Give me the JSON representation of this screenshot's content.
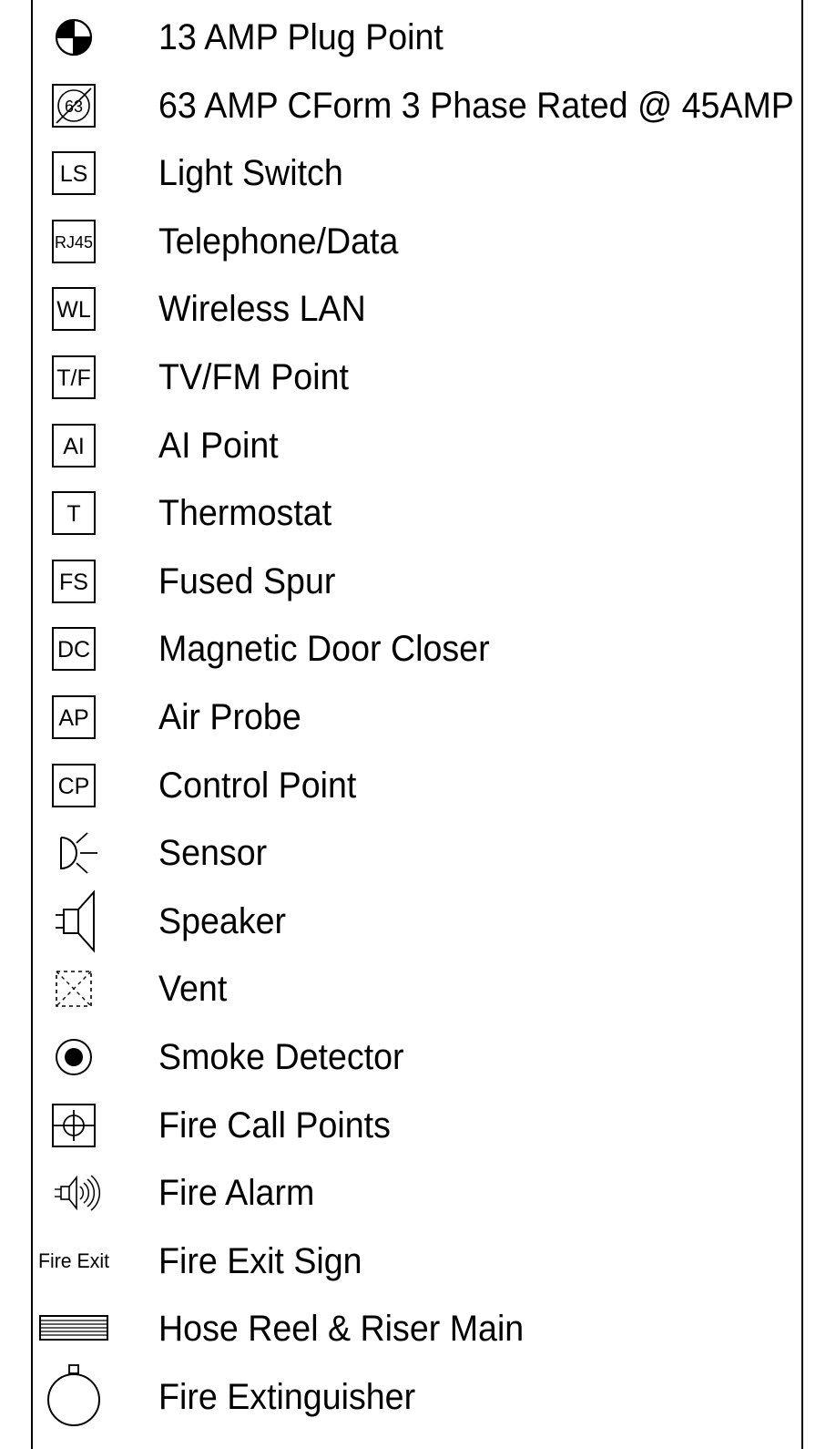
{
  "legend": {
    "items": [
      {
        "label": "13 AMP Plug Point",
        "icon": "plug-point-icon"
      },
      {
        "label": "63 AMP CForm 3 Phase Rated @ 45AMP",
        "icon": "cform-63-icon",
        "symbol_text": "63"
      },
      {
        "label": "Light Switch",
        "icon": "light-switch-icon",
        "symbol_text": "LS"
      },
      {
        "label": "Telephone/Data",
        "icon": "telephone-data-icon",
        "symbol_text": "RJ45"
      },
      {
        "label": "Wireless LAN",
        "icon": "wireless-lan-icon",
        "symbol_text": "WL"
      },
      {
        "label": "TV/FM Point",
        "icon": "tv-fm-icon",
        "symbol_text": "T/F"
      },
      {
        "label": "AI Point",
        "icon": "ai-point-icon",
        "symbol_text": "AI"
      },
      {
        "label": "Thermostat",
        "icon": "thermostat-icon",
        "symbol_text": "T"
      },
      {
        "label": "Fused Spur",
        "icon": "fused-spur-icon",
        "symbol_text": "FS"
      },
      {
        "label": "Magnetic Door Closer",
        "icon": "door-closer-icon",
        "symbol_text": "DC"
      },
      {
        "label": "Air Probe",
        "icon": "air-probe-icon",
        "symbol_text": "AP"
      },
      {
        "label": "Control Point",
        "icon": "control-point-icon",
        "symbol_text": "CP"
      },
      {
        "label": "Sensor",
        "icon": "sensor-icon"
      },
      {
        "label": "Speaker",
        "icon": "speaker-icon"
      },
      {
        "label": "Vent",
        "icon": "vent-icon"
      },
      {
        "label": "Smoke Detector",
        "icon": "smoke-detector-icon"
      },
      {
        "label": "Fire Call Points",
        "icon": "fire-call-point-icon"
      },
      {
        "label": "Fire Alarm",
        "icon": "fire-alarm-icon"
      },
      {
        "label": "Fire Exit Sign",
        "icon": "fire-exit-sign-icon",
        "symbol_text": "Fire Exit"
      },
      {
        "label": "Hose Reel & Riser Main",
        "icon": "hose-reel-icon"
      },
      {
        "label": "Fire Extinguisher",
        "icon": "fire-extinguisher-icon"
      }
    ]
  }
}
